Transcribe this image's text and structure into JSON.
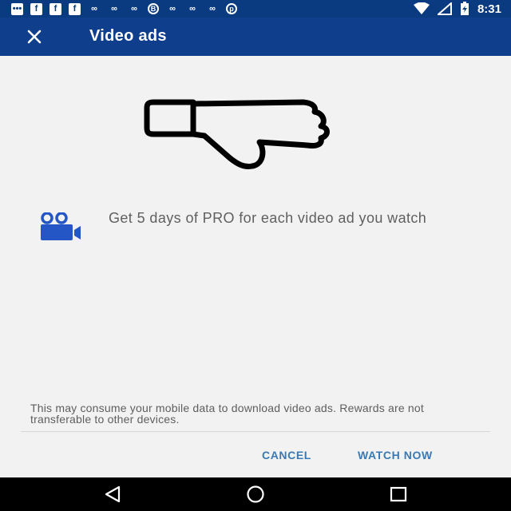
{
  "status_bar": {
    "notification_icons": [
      "message-icon",
      "facebook-icon",
      "facebook-icon",
      "facebook-icon",
      "link-icon",
      "link-icon",
      "link-icon",
      "b-icon",
      "link-icon",
      "link-icon",
      "link-icon",
      "pinterest-icon"
    ],
    "time": "8:31"
  },
  "app_bar": {
    "title": "Video ads",
    "close_icon": "close-icon"
  },
  "content": {
    "hero_icon": "thumbs-down-icon",
    "feature_icon": "video-camera-icon",
    "feature_text": "Get 5 days of PRO for each video ad you watch",
    "disclaimer": "This may consume your mobile data to download video ads. Rewards are not transferable to other devices."
  },
  "actions": {
    "cancel": "CANCEL",
    "watch_now": "WATCH NOW"
  },
  "nav_bar": {
    "icons": [
      "back-icon",
      "home-icon",
      "recents-icon"
    ]
  },
  "colors": {
    "app_bar": "#0f3f8c",
    "status_bar": "#0a3a80",
    "accent": "#3a79b3",
    "feature_icon": "#2457c5"
  }
}
